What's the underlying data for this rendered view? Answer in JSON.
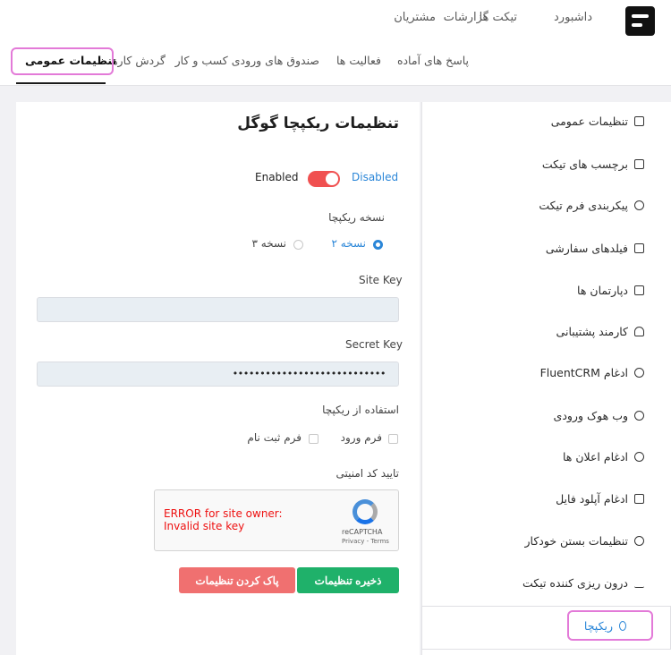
{
  "topnav": [
    "داشبورد",
    "تیکت ها",
    "گزارشات",
    "مشتریان"
  ],
  "subnav": [
    "پاسخ های آماده",
    "صندوق های ورودی کسب و کار",
    "فعالیت ها",
    "گردش کارها",
    "تنظیمات عمومی"
  ],
  "sidebar": {
    "items": [
      {
        "label": "تنظیمات عمومی",
        "icon": "document-icon"
      },
      {
        "label": "برچسب های تیکت",
        "icon": "bookmark-icon"
      },
      {
        "label": "پیکربندی فرم تیکت",
        "icon": "gear-icon"
      },
      {
        "label": "فیلدهای سفارشی",
        "icon": "list-icon"
      },
      {
        "label": "دپارتمان ها",
        "icon": "bag-icon"
      },
      {
        "label": "کارمند پشتیبانی",
        "icon": "user-icon"
      },
      {
        "label": "ادغام FluentCRM",
        "icon": "cog-icon"
      },
      {
        "label": "وب هوک ورودی",
        "icon": "webhook-icon"
      },
      {
        "label": "ادغام اعلان ها",
        "icon": "alarm-icon"
      },
      {
        "label": "ادغام آپلود فایل",
        "icon": "folder-icon"
      },
      {
        "label": "تنظیمات بستن خودکار",
        "icon": "clock-icon"
      },
      {
        "label": "درون ریزی کننده تیکت",
        "icon": "download-icon"
      },
      {
        "label": "ریکپچا",
        "icon": "captcha-icon"
      }
    ]
  },
  "main": {
    "title": "تنظیمات ریکپچا گوگل",
    "toggle": {
      "off_label": "Disabled",
      "on_label": "Enabled",
      "state": "enabled"
    },
    "version_label": "نسخه ریکپچا",
    "versions": [
      "نسخه ۲",
      "نسخه ۳"
    ],
    "site_key_label": "Site Key",
    "site_key_value": "",
    "secret_key_label": "Secret Key",
    "secret_key_value": "••••••••••••••••••••••••••••",
    "usage_label": "استفاده از ریکپچا",
    "usage_options": [
      "فرم ورود",
      "فرم ثبت نام"
    ],
    "security_label": "تایید کد امنیتی",
    "captcha_error": "ERROR for site owner: Invalid site key",
    "captcha_brand": "reCAPTCHA",
    "captcha_links": "Privacy - Terms",
    "save_label": "ذخیره تنظیمات",
    "clear_label": "پاک کردن تنظیمات"
  },
  "colors": {
    "accent": "#2a86d8",
    "toggle_on": "#f05050",
    "save": "#1fb16a",
    "clear": "#f07070",
    "highlight": "#e37ad8"
  }
}
